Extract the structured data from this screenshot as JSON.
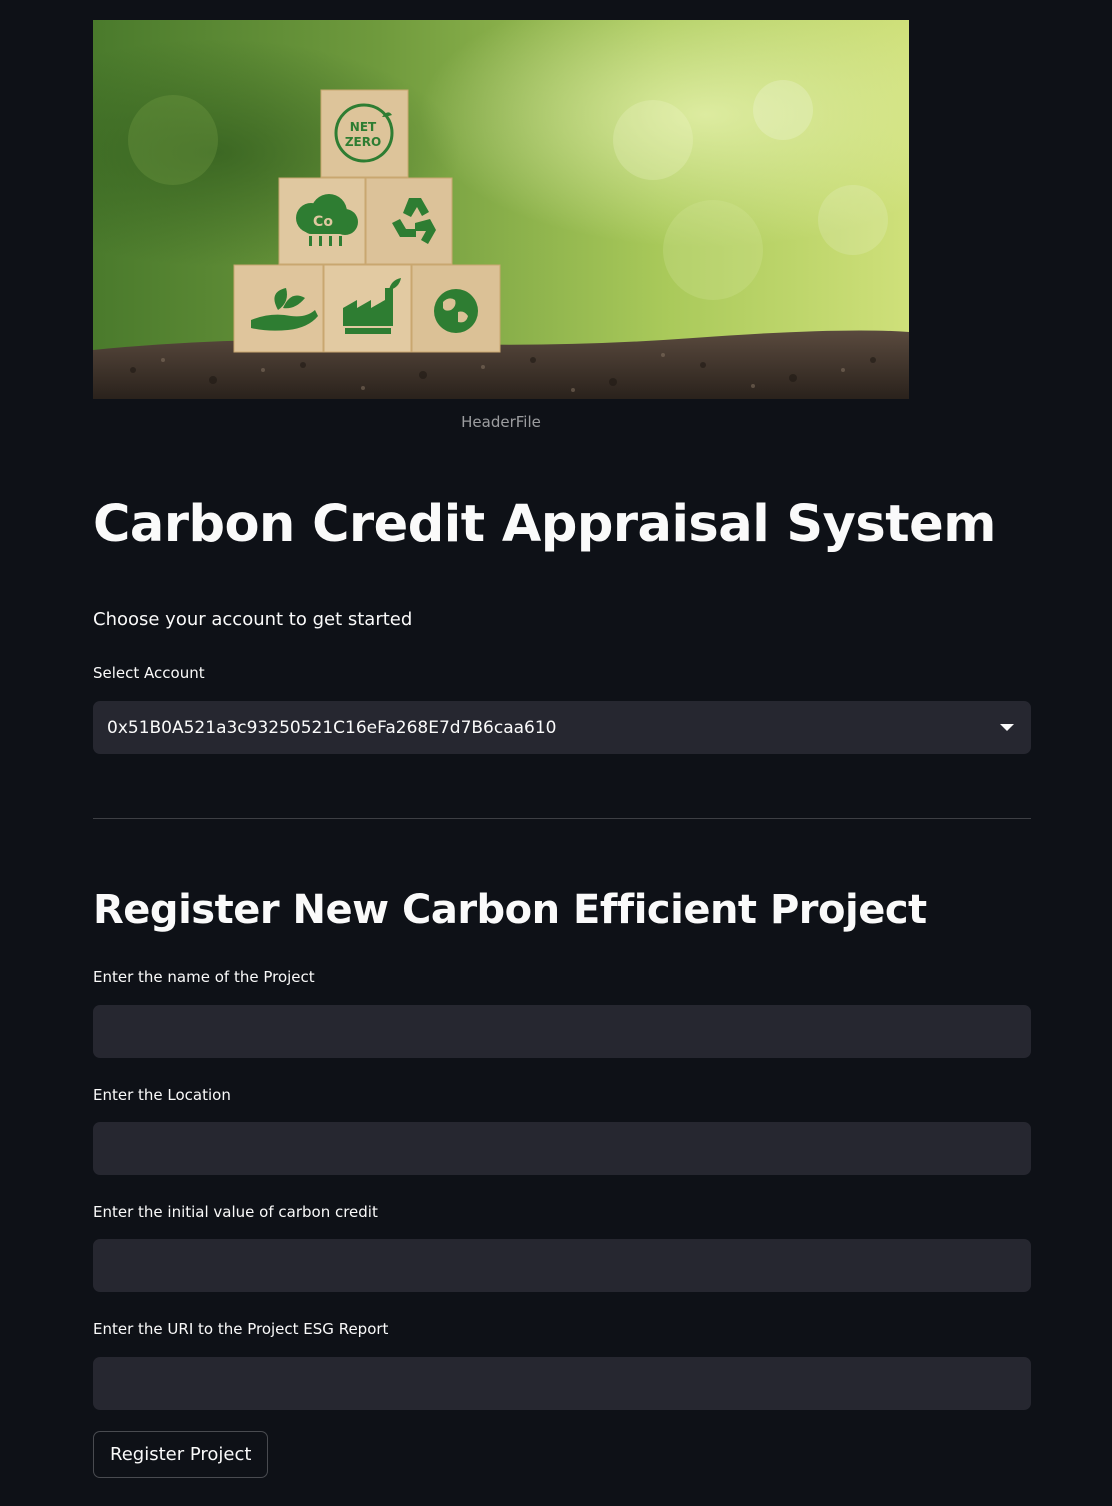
{
  "header_image": {
    "caption": "HeaderFile",
    "blocks": {
      "top": "NET ZERO",
      "middle_left": "CO₂",
      "middle_right": "recycle-icon",
      "bottom_left": "hand-leaf-icon",
      "bottom_center": "factory-icon",
      "bottom_right": "globe-icon"
    }
  },
  "title": "Carbon Credit Appraisal System",
  "intro": "Choose your account to get started",
  "account": {
    "label": "Select Account",
    "selected": "0x51B0A521a3c93250521C16eFa268E7d7B6caa610"
  },
  "register": {
    "heading": "Register New Carbon Efficient Project",
    "fields": [
      {
        "label": "Enter the name of the Project",
        "value": ""
      },
      {
        "label": "Enter the Location",
        "value": ""
      },
      {
        "label": "Enter the initial value of carbon credit",
        "value": ""
      },
      {
        "label": "Enter the URI to the Project ESG Report",
        "value": ""
      }
    ],
    "button_label": "Register Project"
  },
  "colors": {
    "background": "#0e1117",
    "input_background": "#262730",
    "text": "#fafafa",
    "icon_green": "#2e7d32"
  }
}
